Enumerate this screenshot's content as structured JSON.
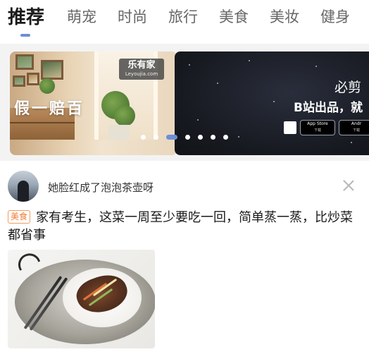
{
  "tabs": [
    {
      "label": "推荐",
      "active": true
    },
    {
      "label": "萌宠"
    },
    {
      "label": "时尚"
    },
    {
      "label": "旅行"
    },
    {
      "label": "美食"
    },
    {
      "label": "美妆"
    },
    {
      "label": "健身"
    }
  ],
  "accent_color": "#6b8fd6",
  "banner": {
    "left_slide": {
      "headline": "假一赔百",
      "brand_name": "乐有家",
      "brand_url": "Leyoujia.com"
    },
    "right_slide": {
      "headline": "必剪",
      "subline": "B站出品，就",
      "store_buttons": [
        {
          "line1": "App Store",
          "line2": "下载"
        },
        {
          "line1": "Andr",
          "line2": "下载"
        }
      ]
    },
    "carousel": {
      "total": 7,
      "active_index": 2
    }
  },
  "feed": {
    "author": "她脸红成了泡泡茶壶呀",
    "tag": "美食",
    "tag_color": "#f07b35",
    "title": "家有考生，这菜一周至少要吃一回，简单蒸一蒸，比炒菜都省事"
  }
}
